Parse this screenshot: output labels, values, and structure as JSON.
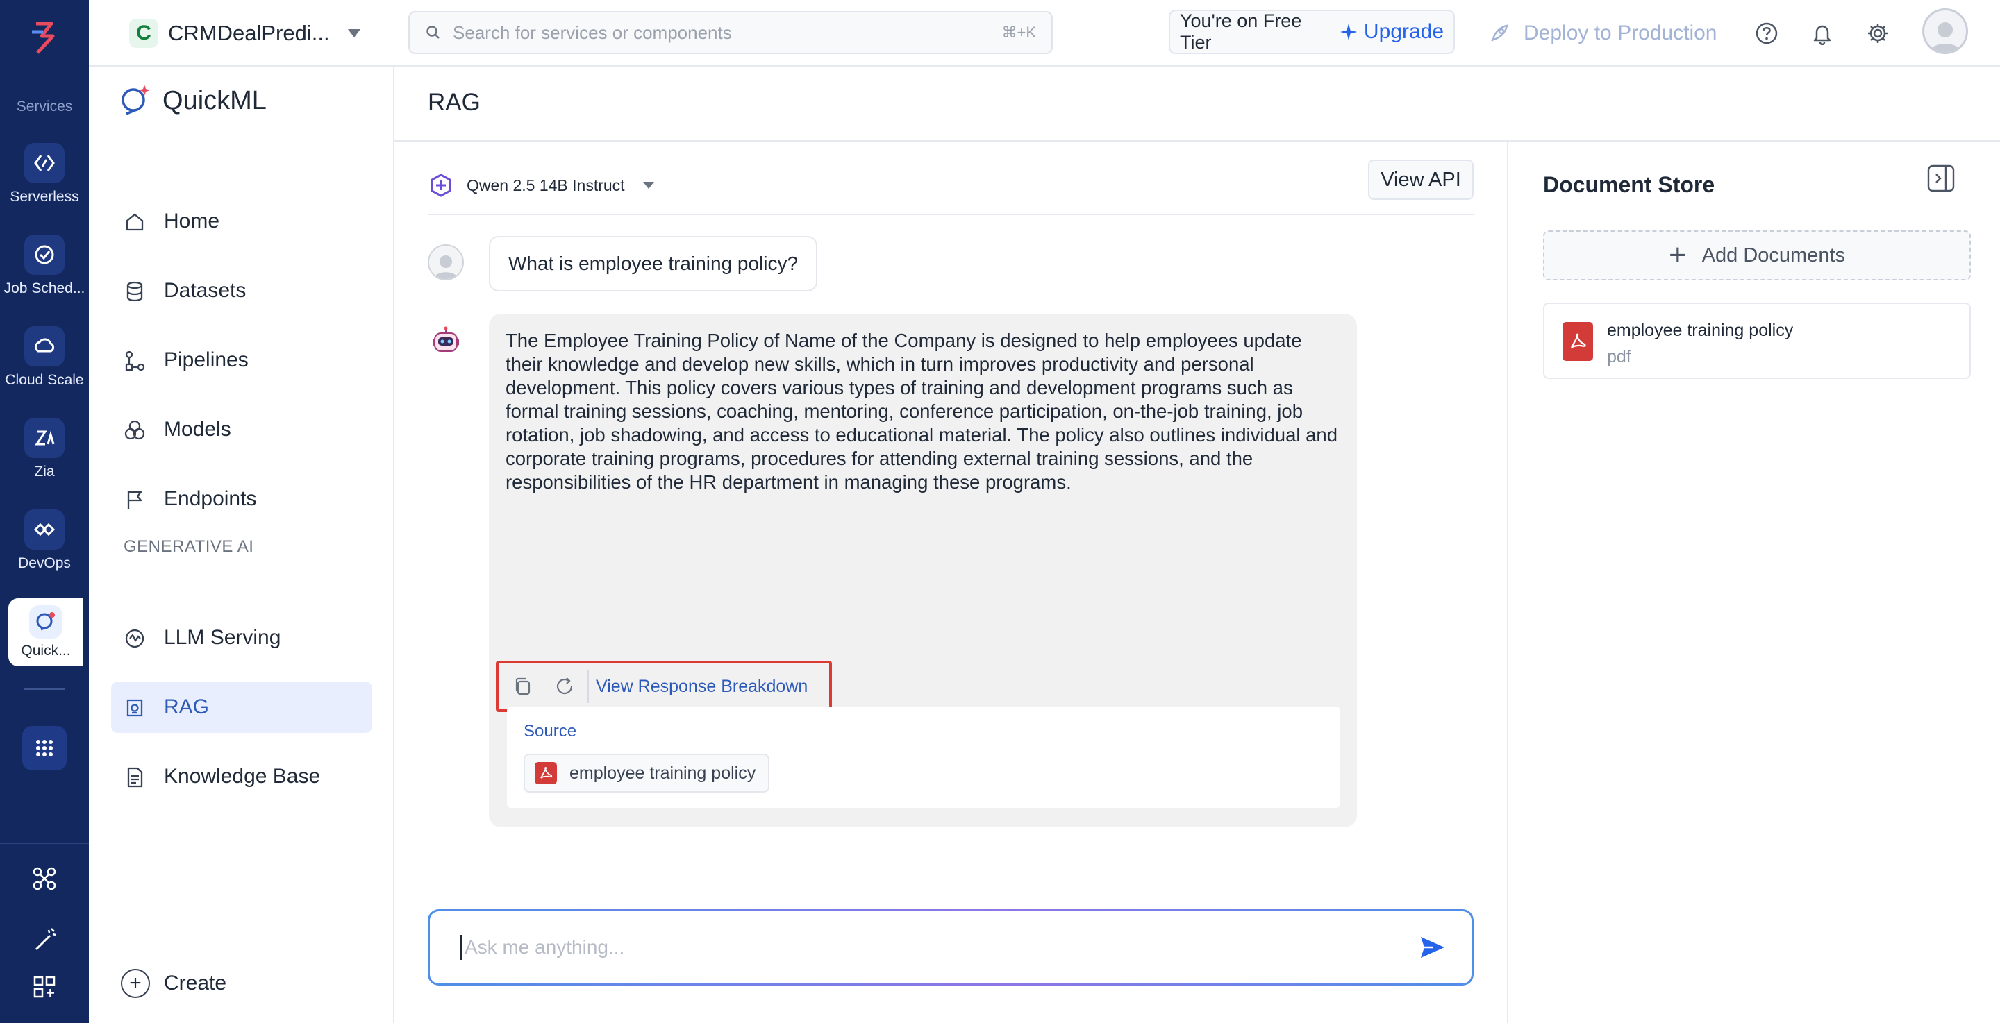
{
  "rail": {
    "section_label": "Services",
    "items": [
      {
        "label": "Serverless",
        "icon": "serverless-icon"
      },
      {
        "label": "Job Sched...",
        "icon": "job-scheduling-icon"
      },
      {
        "label": "Cloud Scale",
        "icon": "cloud-scale-icon"
      },
      {
        "label": "Zia",
        "icon": "zia-icon"
      },
      {
        "label": "DevOps",
        "icon": "devops-icon"
      },
      {
        "label": "Quick...",
        "icon": "quickml-icon",
        "active": true
      }
    ]
  },
  "topbar": {
    "project_initial": "C",
    "project_name": "CRMDealPredi...",
    "search_placeholder": "Search for services or components",
    "search_shortcut": "⌘+K",
    "tier_text": "You're on Free Tier",
    "upgrade_label": "Upgrade",
    "deploy_label": "Deploy to Production"
  },
  "product_nav": {
    "brand": "QuickML",
    "items": [
      {
        "label": "Home",
        "icon": "home-icon"
      },
      {
        "label": "Datasets",
        "icon": "database-icon"
      },
      {
        "label": "Pipelines",
        "icon": "pipeline-icon"
      },
      {
        "label": "Models",
        "icon": "models-icon"
      },
      {
        "label": "Endpoints",
        "icon": "flag-icon"
      }
    ],
    "group_label": "GENERATIVE AI",
    "gen_items": [
      {
        "label": "LLM Serving",
        "icon": "llm-icon"
      },
      {
        "label": "RAG",
        "icon": "rag-icon",
        "active": true
      },
      {
        "label": "Knowledge Base",
        "icon": "document-icon"
      }
    ],
    "create_label": "Create"
  },
  "main": {
    "title": "RAG",
    "model_name": "Qwen 2.5 14B Instruct",
    "view_api_label": "View API",
    "user_message": "What is employee training policy?",
    "bot_message": "The Employee Training Policy of Name of the Company is designed to help employees update their knowledge and develop new skills, which in turn improves productivity and personal development. This policy covers various types of training and development programs such as formal training sessions, coaching, mentoring, conference participation, on-the-job training, job rotation, job shadowing, and access to educational material. The policy also outlines individual and corporate training programs, procedures for attending external training sessions, and the responsibilities of the HR department in managing these programs.",
    "breakdown_label": "View Response Breakdown",
    "source_label": "Source",
    "source_doc": "employee training policy",
    "composer_placeholder": "Ask me anything..."
  },
  "doc_store": {
    "title": "Document Store",
    "add_label": "Add Documents",
    "documents": [
      {
        "name": "employee training policy",
        "type": "pdf"
      }
    ]
  },
  "colors": {
    "rail_bg": "#13285f",
    "accent": "#2d59b8",
    "highlight_box": "#dc3b34",
    "pdf_red": "#d23b38"
  }
}
